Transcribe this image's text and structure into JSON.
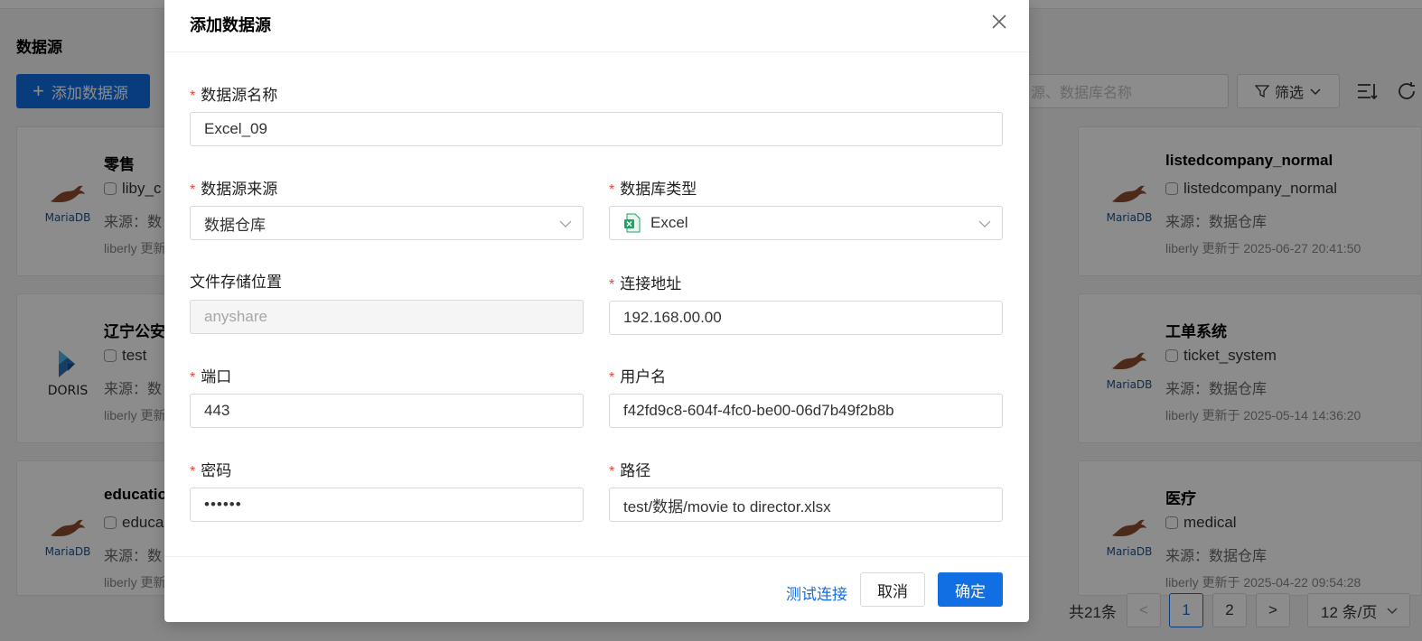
{
  "page": {
    "title": "数据源",
    "add_button": "添加数据源",
    "search_placeholder": "源、数据库名称",
    "filter_label": "筛选"
  },
  "cards": [
    {
      "name": "零售",
      "db": "liby_c",
      "source": "来源：数",
      "updated": "liberly 更新",
      "logo": "MariaDB"
    },
    {
      "name": "辽宁公安",
      "db": "test",
      "source": "来源：数",
      "updated": "liberly 更新",
      "logo": "DORIS"
    },
    {
      "name": "educatio",
      "db": "educa",
      "source": "来源：数",
      "updated": "liberly 更新",
      "logo": "MariaDB"
    },
    {
      "name": "listedcompany_normal",
      "db": "listedcompany_normal",
      "source": "来源：数据仓库",
      "updated": "liberly 更新于 2025-06-27 20:41:50",
      "logo": "MariaDB"
    },
    {
      "name": "工单系统",
      "db": "ticket_system",
      "source": "来源：数据仓库",
      "updated": "liberly 更新于 2025-05-14 14:36:20",
      "logo": "MariaDB"
    },
    {
      "name": "医疗",
      "db": "medical",
      "source": "来源：数据仓库",
      "updated": "liberly 更新于 2025-04-22 09:54:28",
      "logo": "MariaDB"
    }
  ],
  "pagination": {
    "total": "共21条",
    "prev": "<",
    "page1": "1",
    "page2": "2",
    "next": ">",
    "size": "12 条/页"
  },
  "modal": {
    "title": "添加数据源",
    "name_label": "数据源名称",
    "name_value": "Excel_09",
    "source_label": "数据源来源",
    "source_value": "数据仓库",
    "type_label": "数据库类型",
    "type_value": "Excel",
    "storage_label": "文件存储位置",
    "storage_value": "anyshare",
    "address_label": "连接地址",
    "address_value": "192.168.00.00",
    "port_label": "端口",
    "port_value": "443",
    "user_label": "用户名",
    "user_value": "f42fd9c8-604f-4fc0-be00-06d7b49f2b8b",
    "password_label": "密码",
    "password_value": "••••••",
    "path_label": "路径",
    "path_value": "test/数据/movie to director.xlsx",
    "test_link": "测试连接",
    "cancel": "取消",
    "ok": "确定",
    "required_mark": "*"
  },
  "colors": {
    "primary": "#126ee3",
    "required": "#e8433c",
    "excel": "#21a366"
  }
}
